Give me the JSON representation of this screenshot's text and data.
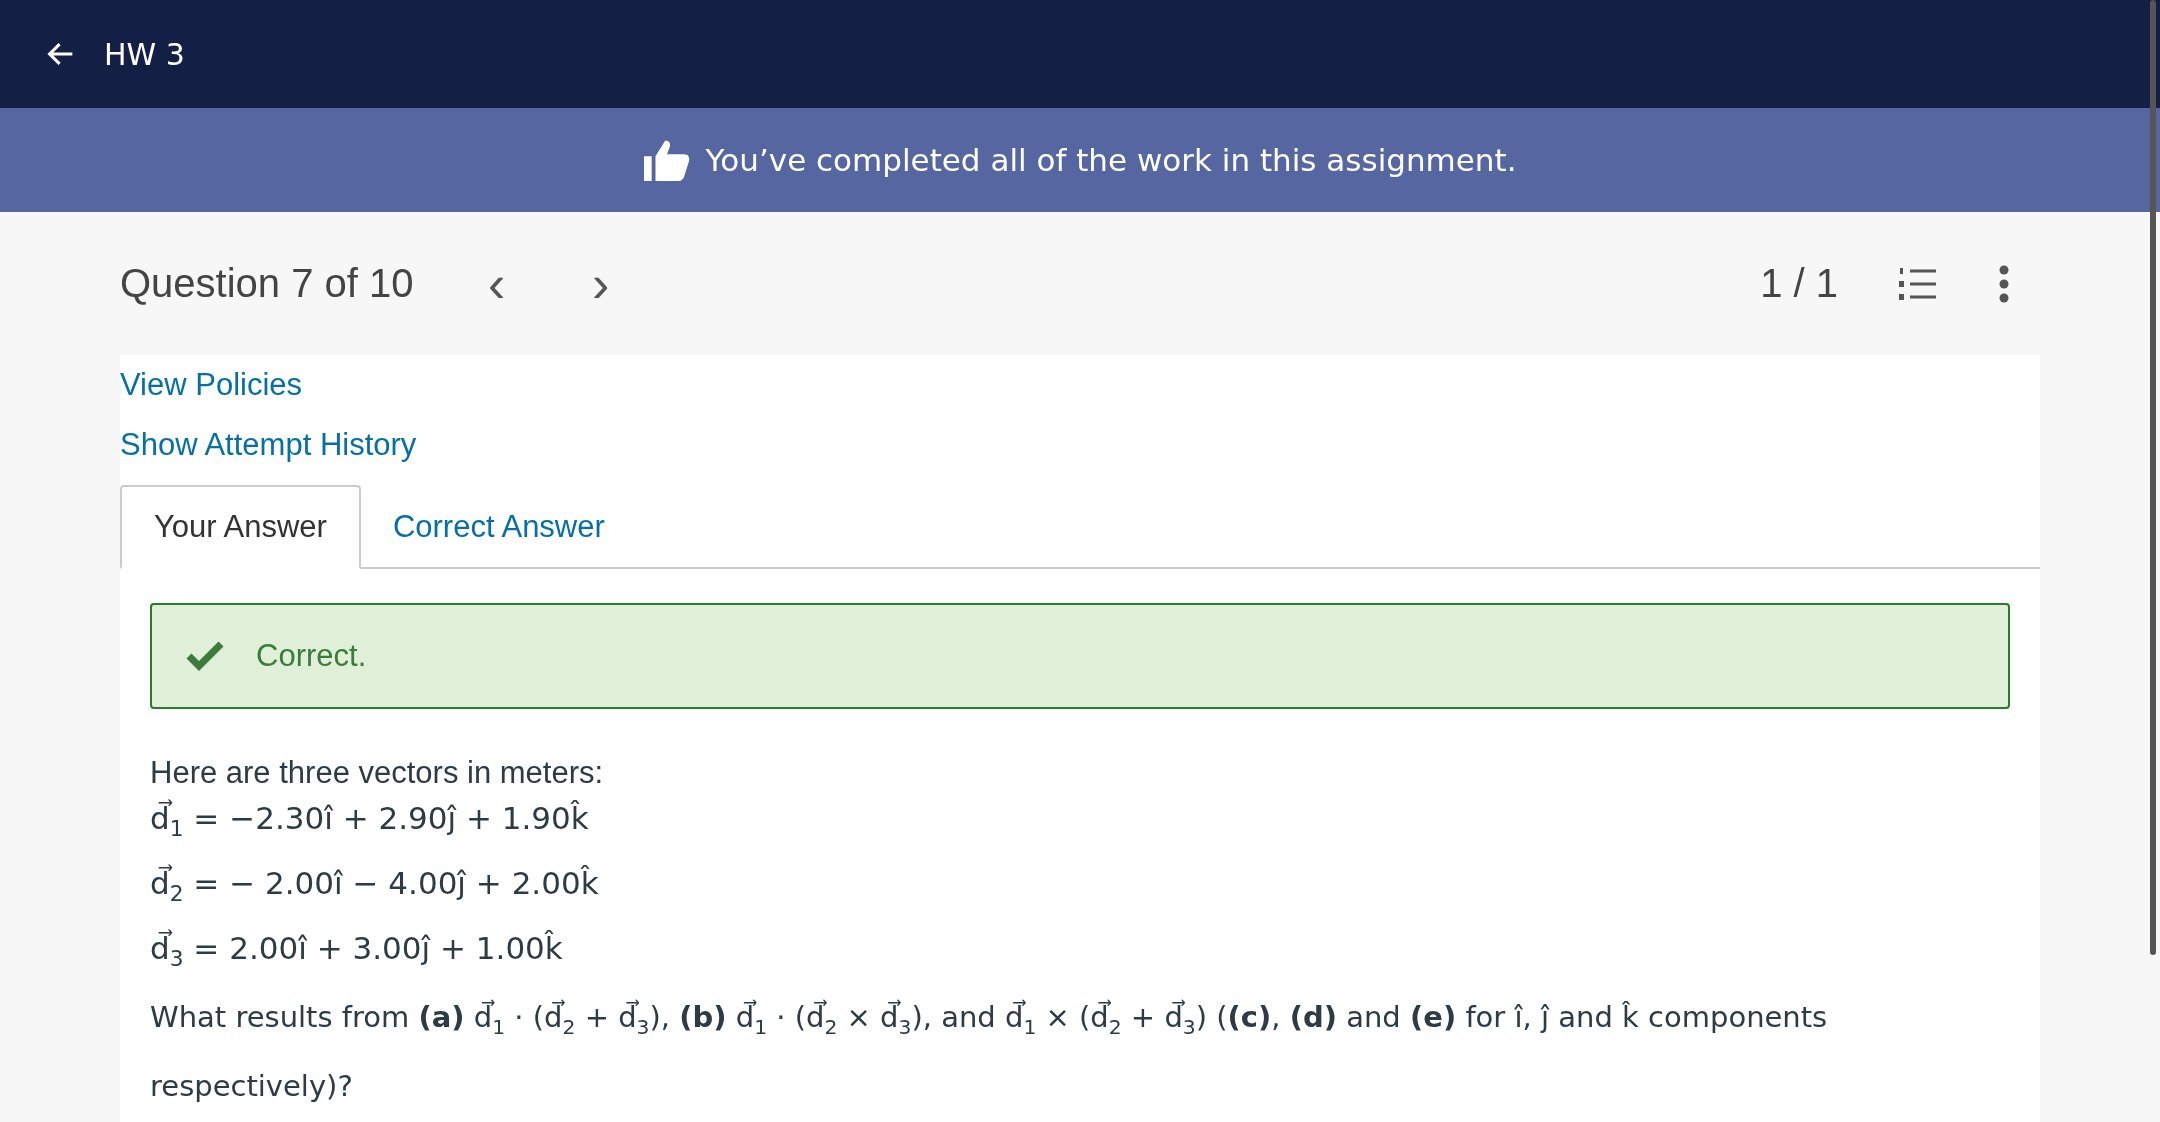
{
  "top_bar": {
    "title": "HW 3"
  },
  "banner": {
    "text": "You’ve completed all of the work in this assignment."
  },
  "question_header": {
    "title": "Question 7 of 10",
    "prev": "‹",
    "next": "›",
    "score": "1 / 1"
  },
  "links": [
    "View Policies",
    "Show Attempt History"
  ],
  "tabs": [
    {
      "label": "Your Answer",
      "selected": true
    },
    {
      "label": "Correct Answer",
      "selected": false
    }
  ],
  "feedback": {
    "correct": true,
    "text": "Correct."
  },
  "question": {
    "intro": "Here are three vectors in meters:",
    "equations": [
      "d⃗$_{1}$ = −2.30î + 2.90ĵ + 1.90k̂",
      "d⃗$_{2}$ = − 2.00î − 4.00ĵ + 2.00k̂",
      "d⃗$_{3}$ = 2.00î + 3.00ĵ + 1.00k̂"
    ],
    "prompt": "What results from **(a)** d⃗$_{1}$ · (d⃗$_{2}$ + d⃗$_{3}$), **(b)** d⃗$_{1}$ · (d⃗$_{2}$ × d⃗$_{3}$), and d⃗$_{1}$ × (d⃗$_{2}$ + d⃗$_{3}$) (**(c)**, **(d)** and **(e)** for î, ĵ and k̂ components respectively)?"
  }
}
